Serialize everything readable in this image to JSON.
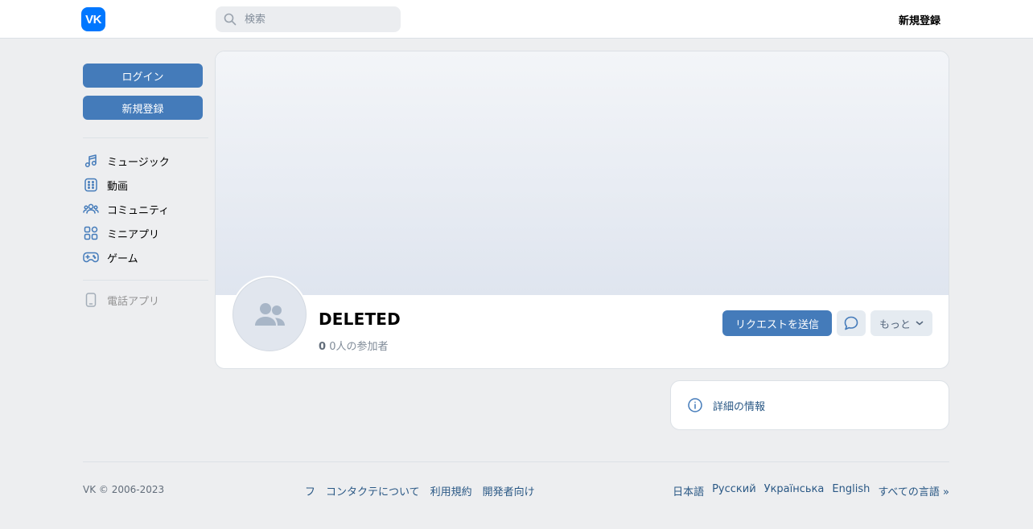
{
  "header": {
    "logo_text": "VK",
    "search_placeholder": "検索",
    "register_label": "新規登録"
  },
  "sidebar": {
    "login_label": "ログイン",
    "register_label": "新規登録",
    "items": [
      {
        "label": "ミュージック",
        "icon": "music-icon"
      },
      {
        "label": "動画",
        "icon": "video-icon"
      },
      {
        "label": "コミュニティ",
        "icon": "community-icon"
      },
      {
        "label": "ミニアプリ",
        "icon": "mini-apps-icon"
      },
      {
        "label": "ゲーム",
        "icon": "gamepad-icon"
      }
    ],
    "phone_app_label": "電話アプリ"
  },
  "group": {
    "name": "DELETED",
    "member_count": "0",
    "member_label": "0人の参加者",
    "send_request_label": "リクエストを送信",
    "more_label": "もっと"
  },
  "info": {
    "label": "詳細の情報"
  },
  "footer": {
    "copyright": "VK © 2006-2023",
    "links": [
      "フ",
      "コンタクテについて",
      "利用規約",
      "開発者向け"
    ],
    "languages": [
      "日本語",
      "Русский",
      "Українська",
      "English",
      "すべての言語 »"
    ]
  },
  "colors": {
    "accent": "#447bba",
    "brand": "#0077ff",
    "link": "#2a5885",
    "background": "#edeef0"
  }
}
